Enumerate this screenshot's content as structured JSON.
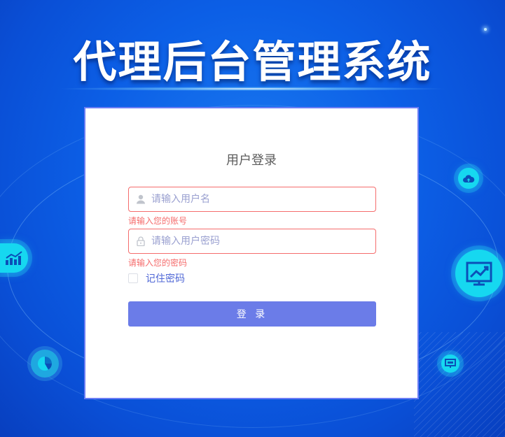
{
  "header": {
    "title": "代理后台管理系统"
  },
  "login": {
    "heading": "用户登录",
    "username": {
      "value": "",
      "placeholder": "请输入用户名",
      "error": "请输入您的账号",
      "icon": "user-icon"
    },
    "password": {
      "value": "",
      "placeholder": "请输入用户密码",
      "error": "请输入您的密码",
      "icon": "lock-icon"
    },
    "remember": {
      "label": "记住密码",
      "checked": false
    },
    "submit_label": "登 录"
  },
  "decor_icons": [
    "cloud-upload-icon",
    "bar-chart-icon",
    "trend-chart-icon",
    "pie-chart-icon",
    "monitor-icon"
  ],
  "colors": {
    "background": "#0c5fe6",
    "accent_cyan": "#16d8f0",
    "button": "#6b7ce8",
    "error": "#f56c6c",
    "card_border": "#6b7df5"
  }
}
